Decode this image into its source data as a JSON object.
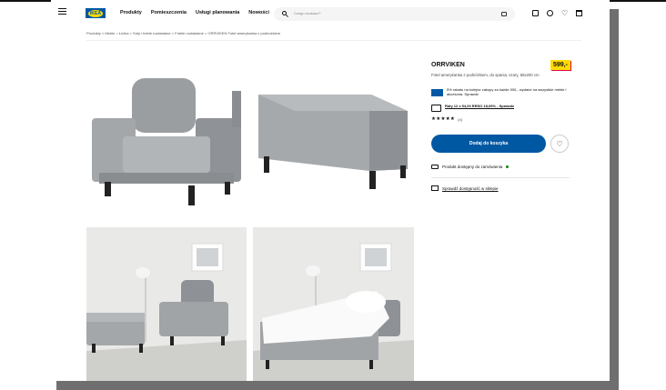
{
  "header": {
    "logo": "IKEA",
    "nav": [
      "Produkty",
      "Pomieszczenia",
      "Usługi planowania",
      "Nowości"
    ],
    "search_placeholder": "Czego szukasz?"
  },
  "breadcrumb": "Produkty > Meble > Łóżka > Sofy i fotele rozkładane > Fotele rozkładane > ORRVIKEN Fotel amerykanka z podnóżkiem",
  "product": {
    "name": "ORRVIKEN",
    "description": "Fotel amerykanka z podnóżkiem, do spania, szary, 80x200 cm",
    "price": "599,-",
    "family_text": "5% rabatu na kolejne zakupy za każde 500,- wydane na wszystkie meble i akcesoria. Sprawdź",
    "finance_text": "Raty 12 x 54,00 RRSO 18,09% - Sprawdź",
    "stars": "★★★★★",
    "rating_count": "(4)",
    "add_to_cart": "Dodaj do koszyka",
    "favourite_icon": "♡",
    "availability": "Produkt dostępny do zamówienia",
    "store_check": "Sprawdź dostępność w sklepie"
  }
}
